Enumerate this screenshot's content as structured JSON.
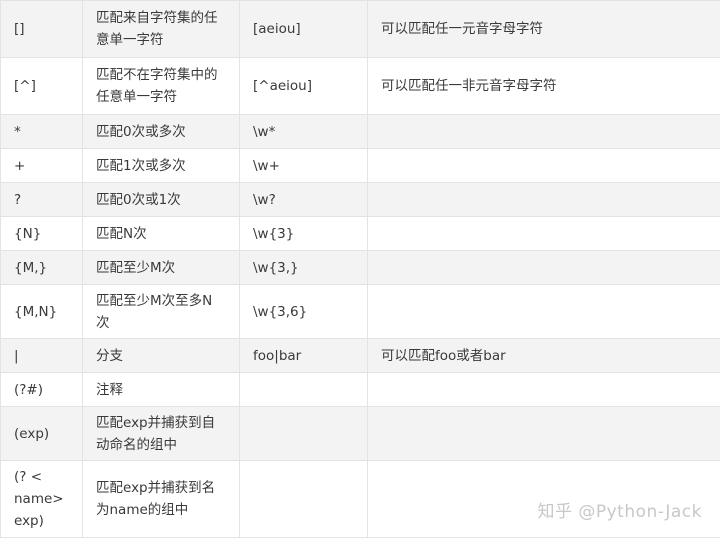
{
  "rows": [
    {
      "syntax": "[]",
      "desc_lines": [
        "匹配来自字符集的任",
        "意单一字符"
      ],
      "example": "[aeiou]",
      "note": "可以匹配任一元音字母字符"
    },
    {
      "syntax": "[^]",
      "desc_lines": [
        "匹配不在字符集中的",
        "任意单一字符"
      ],
      "example": "[^aeiou]",
      "note": "可以匹配任一非元音字母字符"
    },
    {
      "syntax": "*",
      "desc_lines": [
        "匹配0次或多次"
      ],
      "example": "\\w*",
      "note": ""
    },
    {
      "syntax": "+",
      "desc_lines": [
        "匹配1次或多次"
      ],
      "example": "\\w+",
      "note": ""
    },
    {
      "syntax": "?",
      "desc_lines": [
        "匹配0次或1次"
      ],
      "example": "\\w?",
      "note": ""
    },
    {
      "syntax": "{N}",
      "desc_lines": [
        "匹配N次"
      ],
      "example": "\\w{3}",
      "note": ""
    },
    {
      "syntax": "{M,}",
      "desc_lines": [
        "匹配至少M次"
      ],
      "example": "\\w{3,}",
      "note": ""
    },
    {
      "syntax": "{M,N}",
      "desc_lines": [
        "匹配至少M次至多N",
        "次"
      ],
      "example": "\\w{3,6}",
      "note": ""
    },
    {
      "syntax": "|",
      "desc_lines": [
        "分支"
      ],
      "example": "foo|bar",
      "note": "可以匹配foo或者bar"
    },
    {
      "syntax": "(?#)",
      "desc_lines": [
        "注释"
      ],
      "example": "",
      "note": ""
    },
    {
      "syntax": "(exp)",
      "desc_lines": [
        "匹配exp并捕获到自",
        "动命名的组中"
      ],
      "example": "",
      "note": ""
    },
    {
      "syntax_lines": [
        "(? <",
        "name>",
        "exp)"
      ],
      "desc_lines": [
        "匹配exp并捕获到名",
        "为name的组中"
      ],
      "example": "",
      "note": ""
    }
  ],
  "watermark": "知乎 @Python-Jack"
}
